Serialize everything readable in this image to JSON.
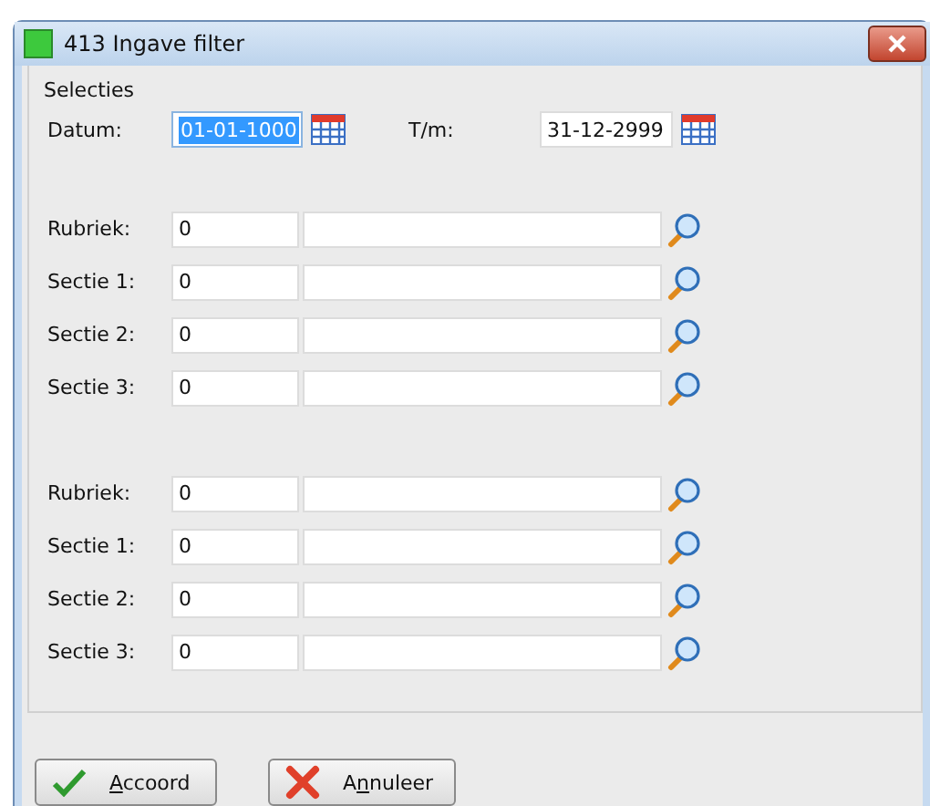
{
  "window": {
    "title": "413 Ingave filter"
  },
  "group": {
    "title": "Selecties"
  },
  "date_range": [
    {
      "label": "Datum:",
      "value": "01-01-1000",
      "selected": true
    },
    {
      "label": "T/m:",
      "value": "31-12-2999",
      "selected": false
    }
  ],
  "lookup_blocks": [
    {
      "rows": [
        {
          "label": "Rubriek:",
          "code": "0"
        },
        {
          "label": "Sectie 1:",
          "code": "0"
        },
        {
          "label": "Sectie 2:",
          "code": "0"
        },
        {
          "label": "Sectie 3:",
          "code": "0"
        }
      ]
    },
    {
      "rows": [
        {
          "label": "Rubriek:",
          "code": "0"
        },
        {
          "label": "Sectie 1:",
          "code": "0"
        },
        {
          "label": "Sectie 2:",
          "code": "0"
        },
        {
          "label": "Sectie 3:",
          "code": "0"
        }
      ]
    }
  ],
  "buttons": [
    {
      "kind": "ok",
      "key": "A",
      "after": "ccoord"
    },
    {
      "kind": "cancel",
      "before": "A",
      "key": "n",
      "after": "nuleer"
    }
  ]
}
